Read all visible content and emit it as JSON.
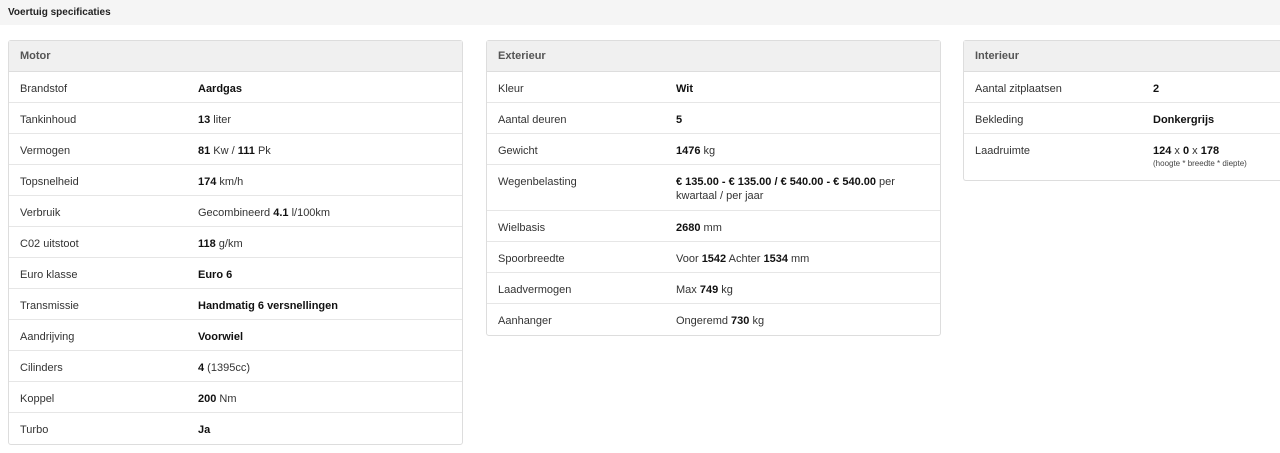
{
  "page": {
    "title": "Voertuig specificaties"
  },
  "motor": {
    "header": "Motor",
    "rows": [
      {
        "label": "Brandstof",
        "v1": "Aardgas"
      },
      {
        "label": "Tankinhoud",
        "v1": "13",
        "t1": " liter"
      },
      {
        "label": "Vermogen",
        "v1": "81",
        "t1": " Kw / ",
        "v2": "111",
        "t2": " Pk"
      },
      {
        "label": "Topsnelheid",
        "v1": "174",
        "t1": " km/h"
      },
      {
        "label": "Verbruik",
        "t0": "Gecombineerd ",
        "v1": "4.1",
        "t1": " l/100km"
      },
      {
        "label": "C02 uitstoot",
        "v1": "118",
        "t1": " g/km"
      },
      {
        "label": "Euro klasse",
        "v1": "Euro 6"
      },
      {
        "label": "Transmissie",
        "v1": "Handmatig 6 versnellingen"
      },
      {
        "label": "Aandrijving",
        "v1": "Voorwiel"
      },
      {
        "label": "Cilinders",
        "v1": "4",
        "t1": " (1395cc)"
      },
      {
        "label": "Koppel",
        "v1": "200",
        "t1": " Nm"
      },
      {
        "label": "Turbo",
        "v1": "Ja"
      }
    ]
  },
  "exterieur": {
    "header": "Exterieur",
    "rows": [
      {
        "label": "Kleur",
        "v1": "Wit"
      },
      {
        "label": "Aantal deuren",
        "v1": "5"
      },
      {
        "label": "Gewicht",
        "v1": "1476",
        "t1": " kg"
      },
      {
        "label": "Wegenbelasting",
        "v1": "€ 135.00 - € 135.00 / € 540.00 - € 540.00",
        "t1": " per kwartaal / per jaar"
      },
      {
        "label": "Wielbasis",
        "v1": "2680",
        "t1": " mm"
      },
      {
        "label": "Spoorbreedte",
        "t0": "Voor ",
        "v1": "1542",
        "t1": " Achter ",
        "v2": "1534",
        "t2": " mm"
      },
      {
        "label": "Laadvermogen",
        "t0": "Max ",
        "v1": "749",
        "t1": " kg"
      },
      {
        "label": "Aanhanger",
        "t0": "Ongeremd ",
        "v1": "730",
        "t1": " kg"
      }
    ]
  },
  "interieur": {
    "header": "Interieur",
    "rows": [
      {
        "label": "Aantal zitplaatsen",
        "v1": "2"
      },
      {
        "label": "Bekleding",
        "v1": "Donkergrijs"
      },
      {
        "label": "Laadruimte",
        "v1": "124",
        "t1": " x ",
        "v2": "0",
        "t2": " x ",
        "v3": "178",
        "sub": "(hoogte * breedte * diepte)"
      }
    ]
  }
}
